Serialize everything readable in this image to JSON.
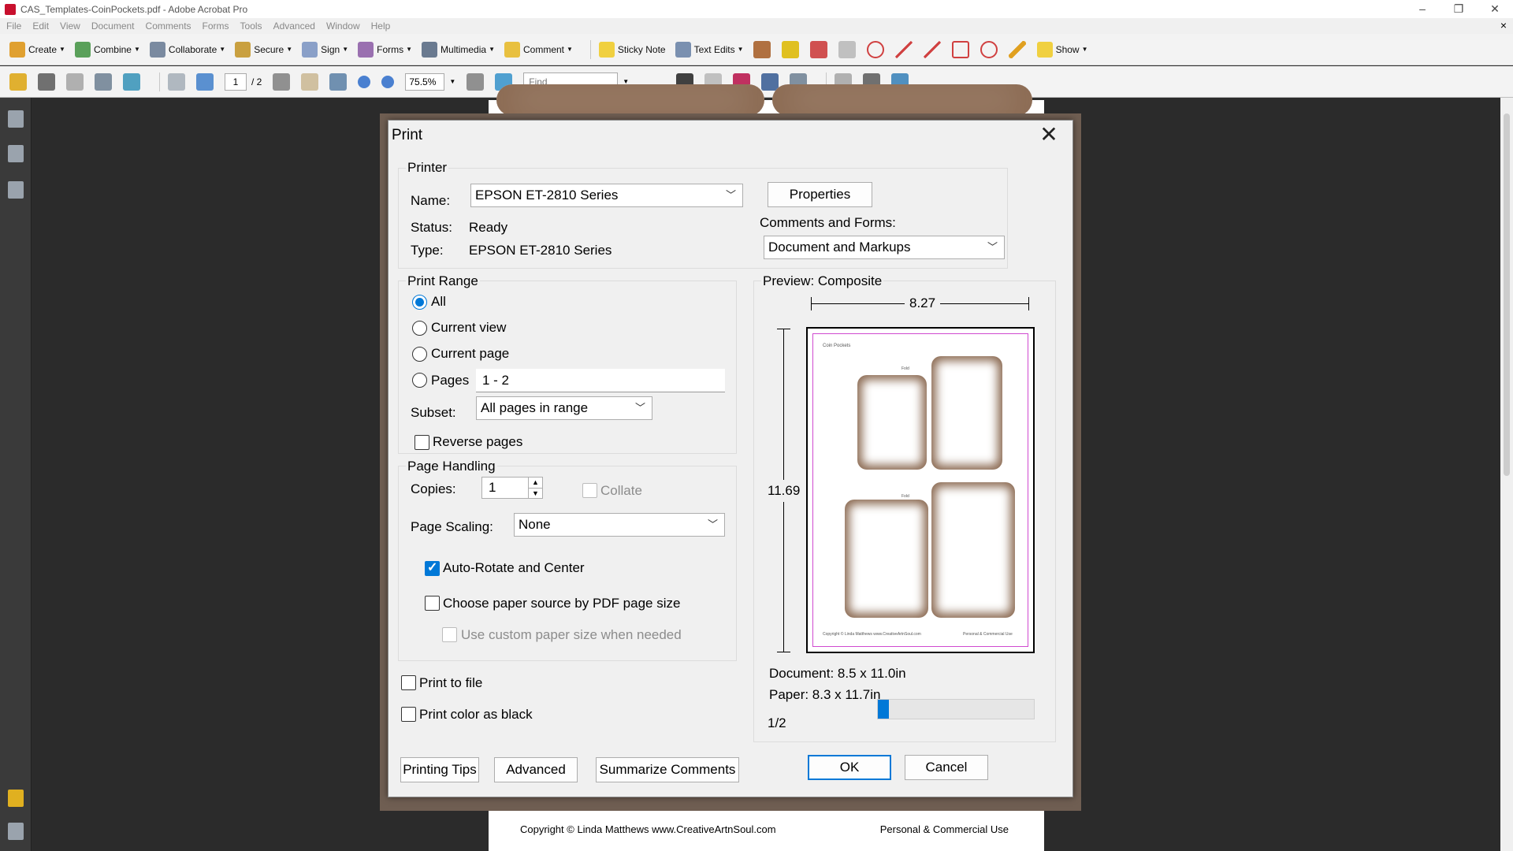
{
  "window": {
    "title": "CAS_Templates-CoinPockets.pdf - Adobe Acrobat Pro",
    "minimize": "–",
    "restore": "❐",
    "close": "✕",
    "doc_close": "×"
  },
  "menu": [
    "File",
    "Edit",
    "View",
    "Document",
    "Comments",
    "Forms",
    "Tools",
    "Advanced",
    "Window",
    "Help"
  ],
  "toolbar1": {
    "create": "Create",
    "combine": "Combine",
    "collaborate": "Collaborate",
    "secure": "Secure",
    "sign": "Sign",
    "forms": "Forms",
    "multimedia": "Multimedia",
    "comment": "Comment",
    "sticky_note": "Sticky Note",
    "text_edits": "Text Edits",
    "show": "Show"
  },
  "toolbar2": {
    "page_current": "1",
    "page_total": "/ 2",
    "zoom": "75.5%",
    "find_placeholder": "Find"
  },
  "document": {
    "footer_left": "Copyright © Linda Matthews www.CreativeArtnSoul.com",
    "footer_right": "Personal & Commercial Use"
  },
  "dialog": {
    "title": "Print",
    "close": "✕",
    "printer": {
      "group": "Printer",
      "name_label": "Name:",
      "name_value": "EPSON ET-2810 Series",
      "status_label": "Status:",
      "status_value": "Ready",
      "type_label": "Type:",
      "type_value": "EPSON ET-2810 Series",
      "properties": "Properties",
      "comments_label": "Comments and Forms:",
      "comments_value": "Document and Markups"
    },
    "range": {
      "group": "Print Range",
      "all": "All",
      "current_view": "Current view",
      "current_page": "Current page",
      "pages": "Pages",
      "pages_value": "1 - 2",
      "subset_label": "Subset:",
      "subset_value": "All pages in range",
      "reverse": "Reverse pages"
    },
    "handling": {
      "group": "Page Handling",
      "copies_label": "Copies:",
      "copies_value": "1",
      "collate": "Collate",
      "scaling_label": "Page Scaling:",
      "scaling_value": "None",
      "auto_rotate": "Auto-Rotate and Center",
      "choose_source": "Choose paper source by PDF page size",
      "custom_size": "Use custom paper size when needed"
    },
    "print_to_file": "Print to file",
    "print_black": "Print color as black",
    "preview": {
      "label": "Preview: Composite",
      "width": "8.27",
      "height": "11.69",
      "document": "Document: 8.5 x 11.0in",
      "paper": "Paper: 8.3 x 11.7in",
      "page_indicator": "1/2",
      "page_progress": 0.05,
      "thumb_title": "Coin Pockets",
      "thumb_fold_1": "Fold",
      "thumb_fold_2": "Fold",
      "thumb_footer_left": "Copyright © Linda Matthews www.CreativeArtnSoul.com",
      "thumb_footer_right": "Personal & Commercial Use"
    },
    "buttons": {
      "tips": "Printing Tips",
      "advanced": "Advanced",
      "summarize": "Summarize Comments",
      "ok": "OK",
      "cancel": "Cancel"
    }
  },
  "colors": {
    "accent": "#0078d7",
    "pocket_shadow": "#8b6a52",
    "preview_border": "#d04ad0"
  }
}
